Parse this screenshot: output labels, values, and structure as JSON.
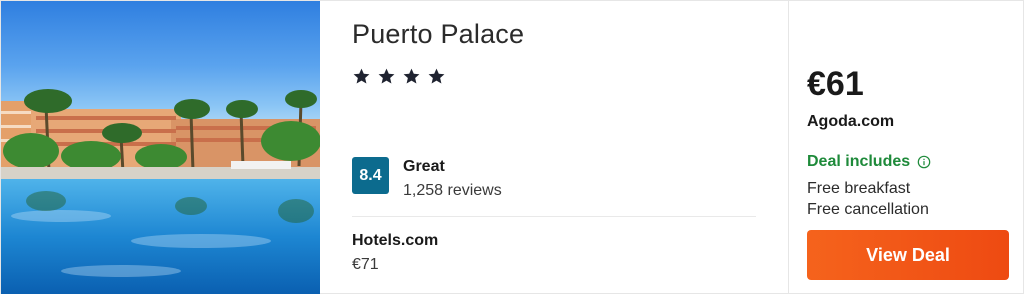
{
  "hotel": {
    "name": "Puerto Palace",
    "star_rating": 4,
    "photo_alt": "hotel-pool-photo"
  },
  "rating": {
    "score": "8.4",
    "label": "Great",
    "reviews": "1,258 reviews",
    "badge_color": "#0c6b8e"
  },
  "alternative": {
    "provider": "Hotels.com",
    "price": "€71"
  },
  "deal": {
    "price": "€61",
    "provider": "Agoda.com",
    "includes_title": "Deal includes",
    "includes_icon": "info-icon",
    "includes": [
      "Free breakfast",
      "Free cancellation"
    ],
    "button_label": "View Deal",
    "accent_green": "#1e8a3a",
    "button_color": "#f5631c"
  }
}
